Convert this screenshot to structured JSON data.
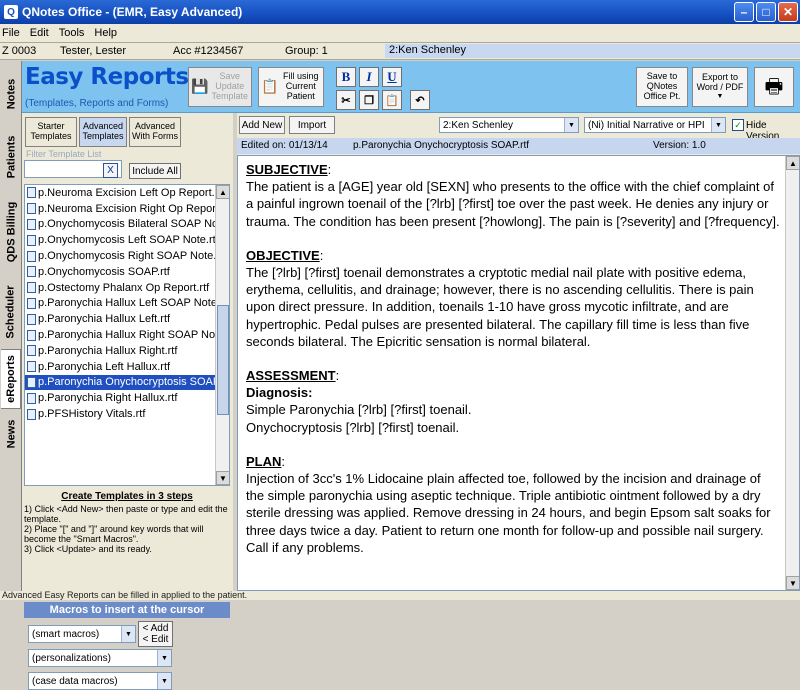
{
  "window": {
    "title": "QNotes Office - (EMR, Easy Advanced)"
  },
  "menu": [
    "File",
    "Edit",
    "Tools",
    "Help"
  ],
  "patient": {
    "id": "Z 0003",
    "name": "Tester, Lester",
    "acc": "Acc #1234567",
    "group": "Group: 1",
    "provider": "2:Ken Schenley"
  },
  "side_tabs": [
    "Notes",
    "Patients",
    "QDS Billing",
    "Scheduler",
    "eReports",
    "News"
  ],
  "header": {
    "title": "Easy Reports",
    "subtitle": "(Templates, Reports and Forms)",
    "save_update": "Save Update Template",
    "fill_current": "Fill using Current Patient",
    "save_office": "Save to QNotes Office Pt.",
    "export": "Export to Word / PDF",
    "bold": "B",
    "italic": "I",
    "underline": "U"
  },
  "left": {
    "tabs": [
      "Starter Templates",
      "Advanced Templates",
      "Advanced With Forms"
    ],
    "filter_label": "Filter Template List",
    "clear": "X",
    "include_all": "Include All",
    "files": [
      "p.Neuroma Excision Left Op Report.rtf",
      "p.Neuroma Excision Right Op Report.rtf",
      "p.Onychomycosis Bilateral SOAP Note.",
      "p.Onychomycosis Left SOAP Note.rtf",
      "p.Onychomycosis Right SOAP Note.rtf",
      "p.Onychomycosis SOAP.rtf",
      "p.Ostectomy Phalanx Op Report.rtf",
      "p.Paronychia Hallux Left SOAP Note.rtf",
      "p.Paronychia Hallux Left.rtf",
      "p.Paronychia Hallux Right SOAP Note.r",
      "p.Paronychia Hallux Right.rtf",
      "p.Paronychia Left Hallux.rtf",
      "p.Paronychia Onychocryptosis SOAP.rtf",
      "p.Paronychia Right Hallux.rtf",
      "p.PFSHistory Vitals.rtf"
    ],
    "selected_index": 12,
    "steps_title": "Create Templates in 3 steps",
    "steps": [
      "1) Click <Add New> then paste or type  and edit the template.",
      "2) Place \"[\" and \"]\" around key words that will become the \"Smart Macros\".",
      "3) Click <Update> and its ready."
    ],
    "macros_title": "Macros to insert at the cursor",
    "macro_selects": [
      "(smart macros)",
      "(personalizations)",
      "(case data macros)"
    ],
    "add_edit": "< Add\n< Edit"
  },
  "right": {
    "add_new": "Add New",
    "import": "Import",
    "provider_select": "2:Ken Schenley",
    "section_select": "(Ni) Initial Narrative or HPI",
    "hide_version": "Hide Version",
    "edited_on": "Edited on: 01/13/14",
    "file_name": "p.Paronychia Onychocryptosis SOAP.rtf",
    "version": "Version: 1.0"
  },
  "document": {
    "subjective_hd": "SUBJECTIVE",
    "subjective": "The patient is a [AGE] year old [SEXN] who presents to the office with the chief complaint of a painful ingrown toenail of the [?lrb] [?first] toe over the past week. He denies any injury or trauma. The condition has been present [?howlong]. The pain is [?severity] and [?frequency].",
    "objective_hd": "OBJECTIVE",
    "objective": "The [?lrb] [?first] toenail demonstrates a cryptotic medial nail plate with positive edema, erythema, cellulitis, and drainage; however, there is no ascending cellulitis. There is pain upon direct pressure. In addition, toenails 1-10 have gross mycotic infiltrate, and are hypertrophic. Pedal pulses are presented bilateral. The capillary fill time is less than five seconds bilateral. The Epicritic sensation is normal bilateral.",
    "assessment_hd": "ASSESSMENT",
    "diagnosis": "Diagnosis:",
    "diag1": "Simple Paronychia [?lrb] [?first] toenail.",
    "diag2": "Onychocryptosis [?lrb] [?first] toenail.",
    "plan_hd": "PLAN",
    "plan": "Injection of 3cc's 1% Lidocaine plain affected toe, followed by the incision and drainage of the simple paronychia using aseptic technique.  Triple antibiotic ointment followed by a dry sterile dressing was applied.  Remove dressing in 24 hours, and begin Epsom salt soaks for three days twice a day. Patient to return one month for follow-up and possible nail surgery. Call if any problems."
  },
  "status": "Advanced Easy Reports can be filled in applied to the patient."
}
